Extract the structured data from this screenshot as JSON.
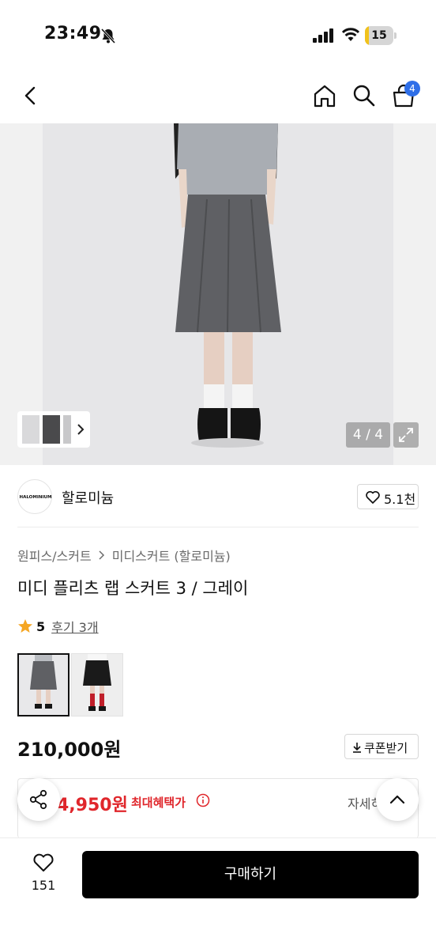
{
  "status_bar": {
    "time": "23:49",
    "battery_label": "15",
    "battery_level": 0.15,
    "icons": [
      "bell-slash-icon",
      "signal-icon",
      "wifi-icon",
      "battery-icon"
    ]
  },
  "nav": {
    "icons": [
      "back-icon",
      "home-icon",
      "search-icon",
      "cart-icon"
    ],
    "cart_badge": "4"
  },
  "gallery": {
    "page_indicator": "4 / 4",
    "current_page": 4,
    "total_pages": 4
  },
  "brand": {
    "logo_text": "HALOMINIUM",
    "name": "할로미늄",
    "likes": "5.1천"
  },
  "product": {
    "breadcrumb": [
      "원피스/스커트",
      "미디스커트 (할로미늄)"
    ],
    "title": "미디 플리츠 랩 스커트 3 / 그레이",
    "rating": "5",
    "rating_value": 5,
    "reviews": "후기 3개",
    "price": "210,000원",
    "coupon_label": "쿠폰받기"
  },
  "benefit": {
    "price": "4,950원",
    "label": "최대혜택가",
    "detail": "자세히"
  },
  "bottom_bar": {
    "wish_count": "151",
    "buy_label": "구매하기"
  },
  "colors": {
    "accent_blue": "#2f6fe8",
    "sale_red": "#e0262b",
    "rating_star": "#f5a623",
    "buy_button": "#000000"
  }
}
